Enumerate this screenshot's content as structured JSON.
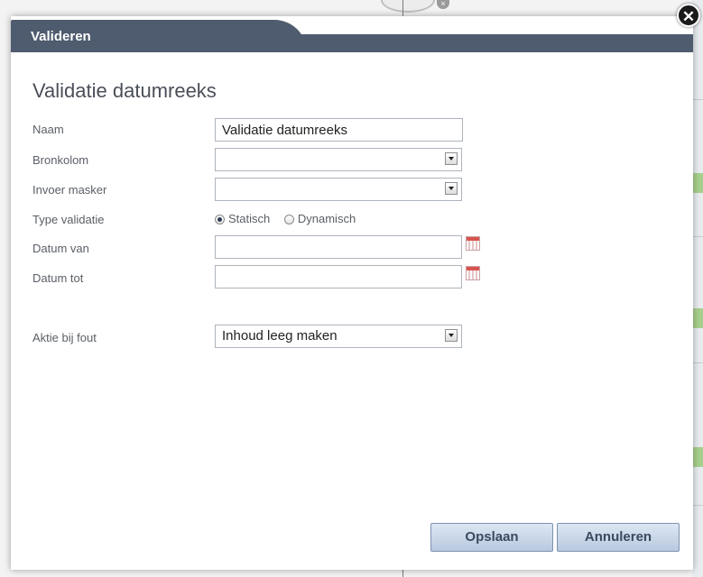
{
  "dialog": {
    "title": "Valideren",
    "heading": "Validatie datumreeks",
    "close_icon": "close-icon"
  },
  "form": {
    "name": {
      "label": "Naam",
      "value": "Validatie datumreeks"
    },
    "source_column": {
      "label": "Bronkolom",
      "value": ""
    },
    "input_mask": {
      "label": "Invoer masker",
      "value": ""
    },
    "validation_type": {
      "label": "Type validatie",
      "options": [
        "Statisch",
        "Dynamisch"
      ],
      "selected": "Statisch"
    },
    "date_from": {
      "label": "Datum van",
      "value": "",
      "icon": "calendar-icon"
    },
    "date_to": {
      "label": "Datum tot",
      "value": "",
      "icon": "calendar-icon"
    },
    "action_on_error": {
      "label": "Aktie bij fout",
      "value": "Inhoud leeg maken"
    }
  },
  "buttons": {
    "save": "Opslaan",
    "cancel": "Annuleren"
  },
  "colors": {
    "titlebar": "#4f5b6e",
    "button_gradient_top": "#dde7f3",
    "button_gradient_bottom": "#b8c9df"
  }
}
